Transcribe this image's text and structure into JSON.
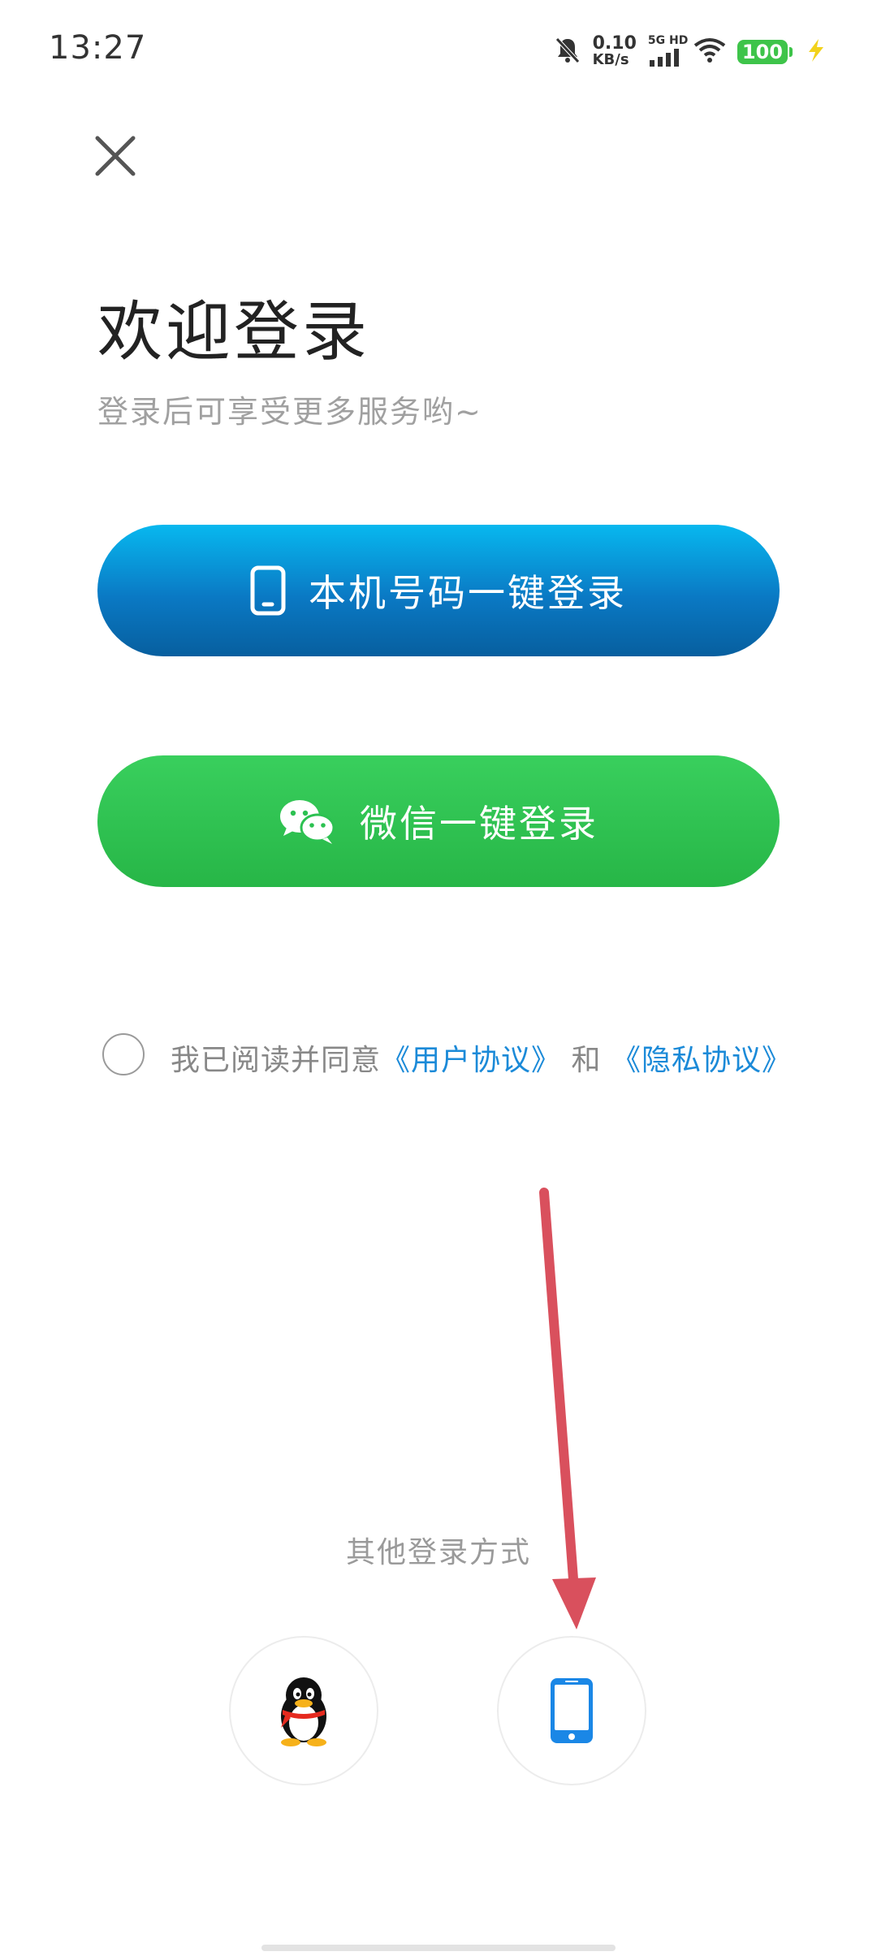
{
  "status_bar": {
    "time": "13:27",
    "net_speed_value": "0.10",
    "net_speed_unit": "KB/s",
    "signal_label": "5G HD",
    "battery": "100",
    "icons": [
      "mute-bell-icon",
      "signal-icon",
      "wifi-icon",
      "battery-icon",
      "charging-icon"
    ]
  },
  "header": {
    "close_icon": "close-icon",
    "title": "欢迎登录",
    "subtitle": "登录后可享受更多服务哟~"
  },
  "buttons": {
    "phone_login": {
      "label": "本机号码一键登录",
      "icon": "mobile-phone-icon",
      "color": "#0a79c4"
    },
    "wechat_login": {
      "label": "微信一键登录",
      "icon": "wechat-icon",
      "color": "#2cc151"
    }
  },
  "agreement": {
    "prefix": "我已阅读并同意",
    "user_agreement": "《用户协议》",
    "conjunction": "和",
    "privacy_policy": "《隐私协议》",
    "checked": false,
    "link_color": "#1b8ad8"
  },
  "other_login": {
    "label": "其他登录方式",
    "options": [
      {
        "icon": "qq-penguin-icon"
      },
      {
        "icon": "mobile-phone-icon"
      }
    ]
  },
  "annotation": {
    "arrow_color": "#d9505d",
    "icon": "red-arrow-annotation"
  }
}
